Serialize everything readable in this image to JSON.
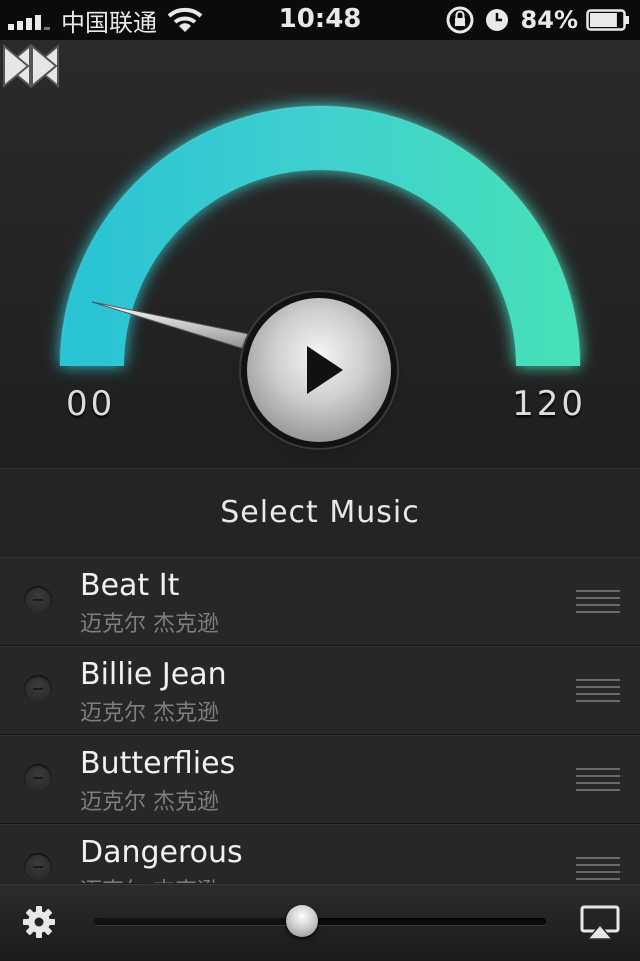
{
  "status_bar": {
    "carrier": "中国联通",
    "time": "10:48",
    "battery_percent": "84%",
    "battery_level": 0.84
  },
  "gauge": {
    "min_label": "00",
    "max_label": "120",
    "needle_value": 0,
    "accent_color": "#3fd6c8"
  },
  "controls": {
    "rewind_icon": "rewind-icon",
    "play_icon": "play-icon",
    "fast_forward_icon": "fast-forward-icon"
  },
  "select_music_label": "Select Music",
  "songs": [
    {
      "title": "Beat It",
      "artist": "迈克尔 杰克逊"
    },
    {
      "title": "Billie Jean",
      "artist": "迈克尔 杰克逊"
    },
    {
      "title": "Butterflies",
      "artist": "迈克尔 杰克逊"
    },
    {
      "title": "Dangerous",
      "artist": "迈克尔 杰克逊"
    }
  ],
  "bottom_bar": {
    "settings_icon": "gear-icon",
    "volume_level": 0.46,
    "airplay_icon": "airplay-icon"
  }
}
